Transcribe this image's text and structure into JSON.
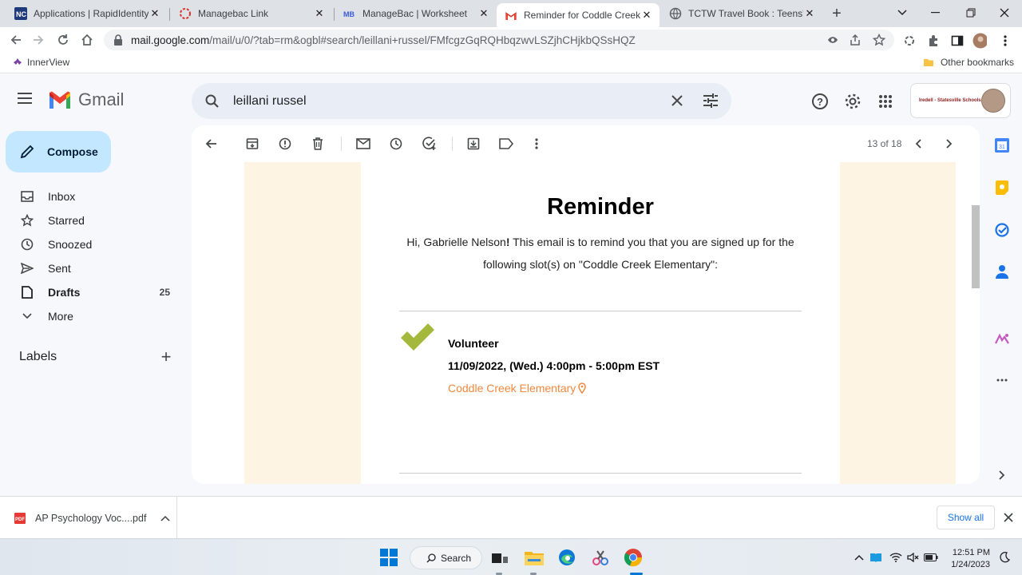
{
  "browser": {
    "tabs": [
      {
        "label": "Applications | RapidIdentity",
        "active": false
      },
      {
        "label": "Managebac Link",
        "active": false
      },
      {
        "label": "ManageBac | Worksheet",
        "active": false
      },
      {
        "label": "Reminder for Coddle Creek E",
        "active": true
      },
      {
        "label": "TCTW Travel Book : Teens' Ca",
        "active": false
      }
    ],
    "url_host": "mail.google.com",
    "url_path": "/mail/u/0/?tab=rm&ogbl#search/leillani+russel/FMfcgzGqRQHbqzwvLSZjhCHjkbQSsHQZ",
    "bookmarks": {
      "left": "InnerView",
      "right": "Other bookmarks"
    }
  },
  "gmail": {
    "brand": "Gmail",
    "search_value": "leillani russel",
    "org_logo_text": "Iredell - Statesville Schools",
    "compose_label": "Compose",
    "nav": [
      {
        "label": "Inbox",
        "icon": "inbox-icon",
        "count": ""
      },
      {
        "label": "Starred",
        "icon": "star-icon",
        "count": ""
      },
      {
        "label": "Snoozed",
        "icon": "clock-icon",
        "count": ""
      },
      {
        "label": "Sent",
        "icon": "send-icon",
        "count": ""
      },
      {
        "label": "Drafts",
        "icon": "draft-icon",
        "count": "25"
      },
      {
        "label": "More",
        "icon": "chevron-down-icon",
        "count": ""
      }
    ],
    "labels_title": "Labels",
    "pager": "13 of 18"
  },
  "email": {
    "title": "Reminder",
    "intro_prefix": "Hi, Gabrielle Nelson",
    "intro_bang": "!",
    "intro_rest": " This email is to remind you that you are signed up for the following slot(s) on \"Coddle Creek Elementary\":",
    "slot": {
      "role": "Volunteer",
      "time": "11/09/2022, (Wed.) 4:00pm - 5:00pm EST",
      "location": "Coddle Creek Elementary"
    },
    "colors": {
      "accent": "#f0883e",
      "check": "#a4b93c",
      "cream": "#fdf4e3"
    }
  },
  "downloads": {
    "file": "AP Psychology Voc....pdf",
    "show_all": "Show all"
  },
  "taskbar": {
    "search_label": "Search",
    "time": "12:51 PM",
    "date": "1/24/2023"
  }
}
